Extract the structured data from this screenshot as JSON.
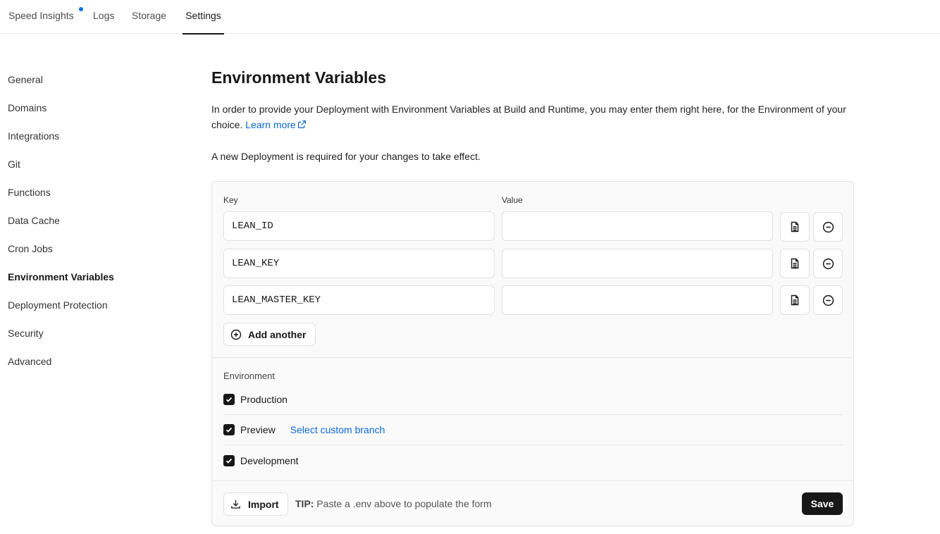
{
  "tabs": [
    {
      "label": "Speed Insights",
      "has_dot": true
    },
    {
      "label": "Logs"
    },
    {
      "label": "Storage"
    },
    {
      "label": "Settings",
      "active": true
    }
  ],
  "sidebar": {
    "items": [
      {
        "label": "General"
      },
      {
        "label": "Domains"
      },
      {
        "label": "Integrations"
      },
      {
        "label": "Git"
      },
      {
        "label": "Functions"
      },
      {
        "label": "Data Cache"
      },
      {
        "label": "Cron Jobs"
      },
      {
        "label": "Environment Variables",
        "active": true
      },
      {
        "label": "Deployment Protection"
      },
      {
        "label": "Security"
      },
      {
        "label": "Advanced"
      }
    ]
  },
  "main": {
    "title": "Environment Variables",
    "description": "In order to provide your Deployment with Environment Variables at Build and Runtime, you may enter them right here, for the Environment of your choice.",
    "learn_more": "Learn more",
    "note": "A new Deployment is required for your changes to take effect."
  },
  "form": {
    "key_label": "Key",
    "value_label": "Value",
    "rows": [
      {
        "key": "LEAN_ID",
        "value": ""
      },
      {
        "key": "LEAN_KEY",
        "value": ""
      },
      {
        "key": "LEAN_MASTER_KEY",
        "value": ""
      }
    ],
    "add_another": "Add another",
    "environment_label": "Environment",
    "environments": [
      {
        "label": "Production",
        "checked": true
      },
      {
        "label": "Preview",
        "checked": true,
        "link": "Select custom branch"
      },
      {
        "label": "Development",
        "checked": true
      }
    ],
    "import_label": "Import",
    "tip_label": "TIP:",
    "tip_text": "Paste a .env above to populate the form",
    "save_label": "Save"
  },
  "colors": {
    "accent": "#0a68d8",
    "dot": "#0a72ef",
    "primary_button": "#171717"
  }
}
